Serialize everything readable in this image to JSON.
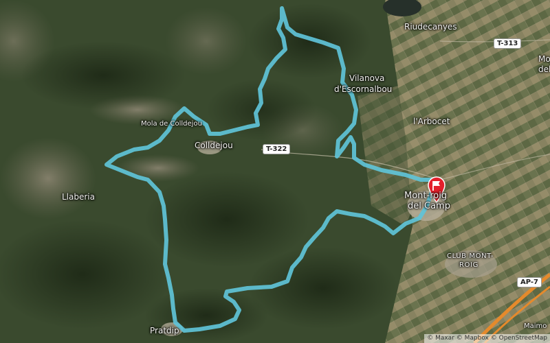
{
  "map": {
    "place_labels": {
      "riudecanyes": "Riudecanyes",
      "vilanova_line1": "Vilanova",
      "vilanova_line2": "d'Escornalbou",
      "arbocet": "l'Arbocet",
      "montroig_line1": "Mont-roig",
      "montroig_line2": "del Camp",
      "club_montroig_line1": "CLUB MONT-",
      "club_montroig_line2": "ROIG",
      "mola_colldejou": "Mola de Colldejou",
      "colldejou": "Colldejou",
      "llaberia": "Llaberia",
      "pratdip": "Pratdip",
      "maspujols_partial": "Mo",
      "maspujols_partial2": "del",
      "maimo_partial": "Maimo"
    },
    "road_shields": {
      "t313": "T-313",
      "t322": "T-322",
      "ap7": "AP-7"
    },
    "route": {
      "color": "#5fc3d8",
      "marker_color": "#e3202c",
      "marker_icon": "flag-icon"
    },
    "attribution": "© Maxar © Mapbox © OpenStreetMap"
  }
}
